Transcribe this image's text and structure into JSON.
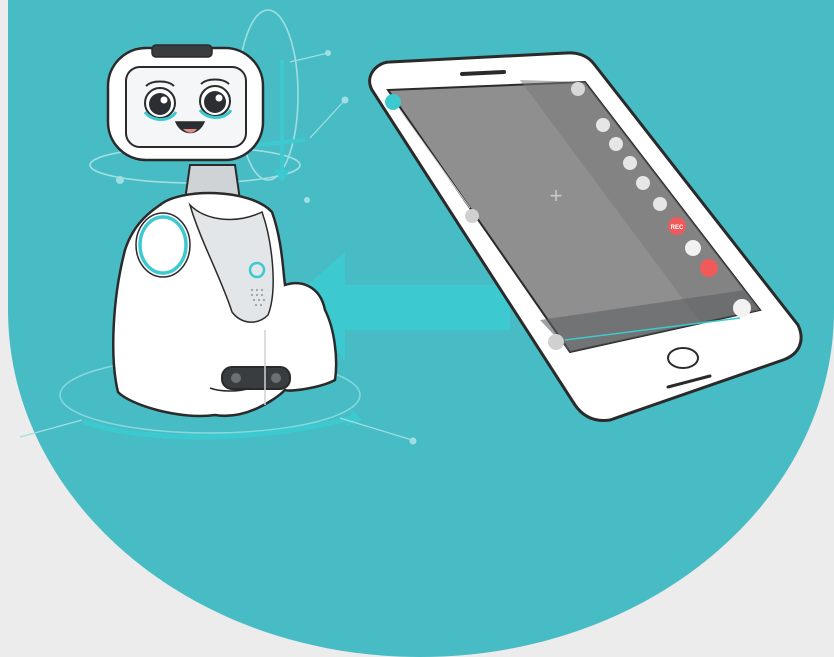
{
  "colors": {
    "background": "#ececec",
    "teal": "#48bcc4",
    "accent_teal": "#3ccad0",
    "robot_body": "#ffffff",
    "outline": "#2a2a2a",
    "phone_screen": "#8f8f8f",
    "record_red": "#f05a5a"
  },
  "icons": {
    "phone_top_left": "home-icon",
    "phone_bottom_left": "joystick-icon",
    "phone_bottom_right": "robot-icon",
    "phone_top_right": "chevron-up-icon",
    "side_controls": [
      "camera-icon",
      "photo-icon",
      "eye-icon",
      "heart-icon",
      "volume-icon",
      "record-button",
      "scissors-icon",
      "stop-button"
    ]
  },
  "phone_ui": {
    "record_label": "REC",
    "crosshair": "+"
  }
}
